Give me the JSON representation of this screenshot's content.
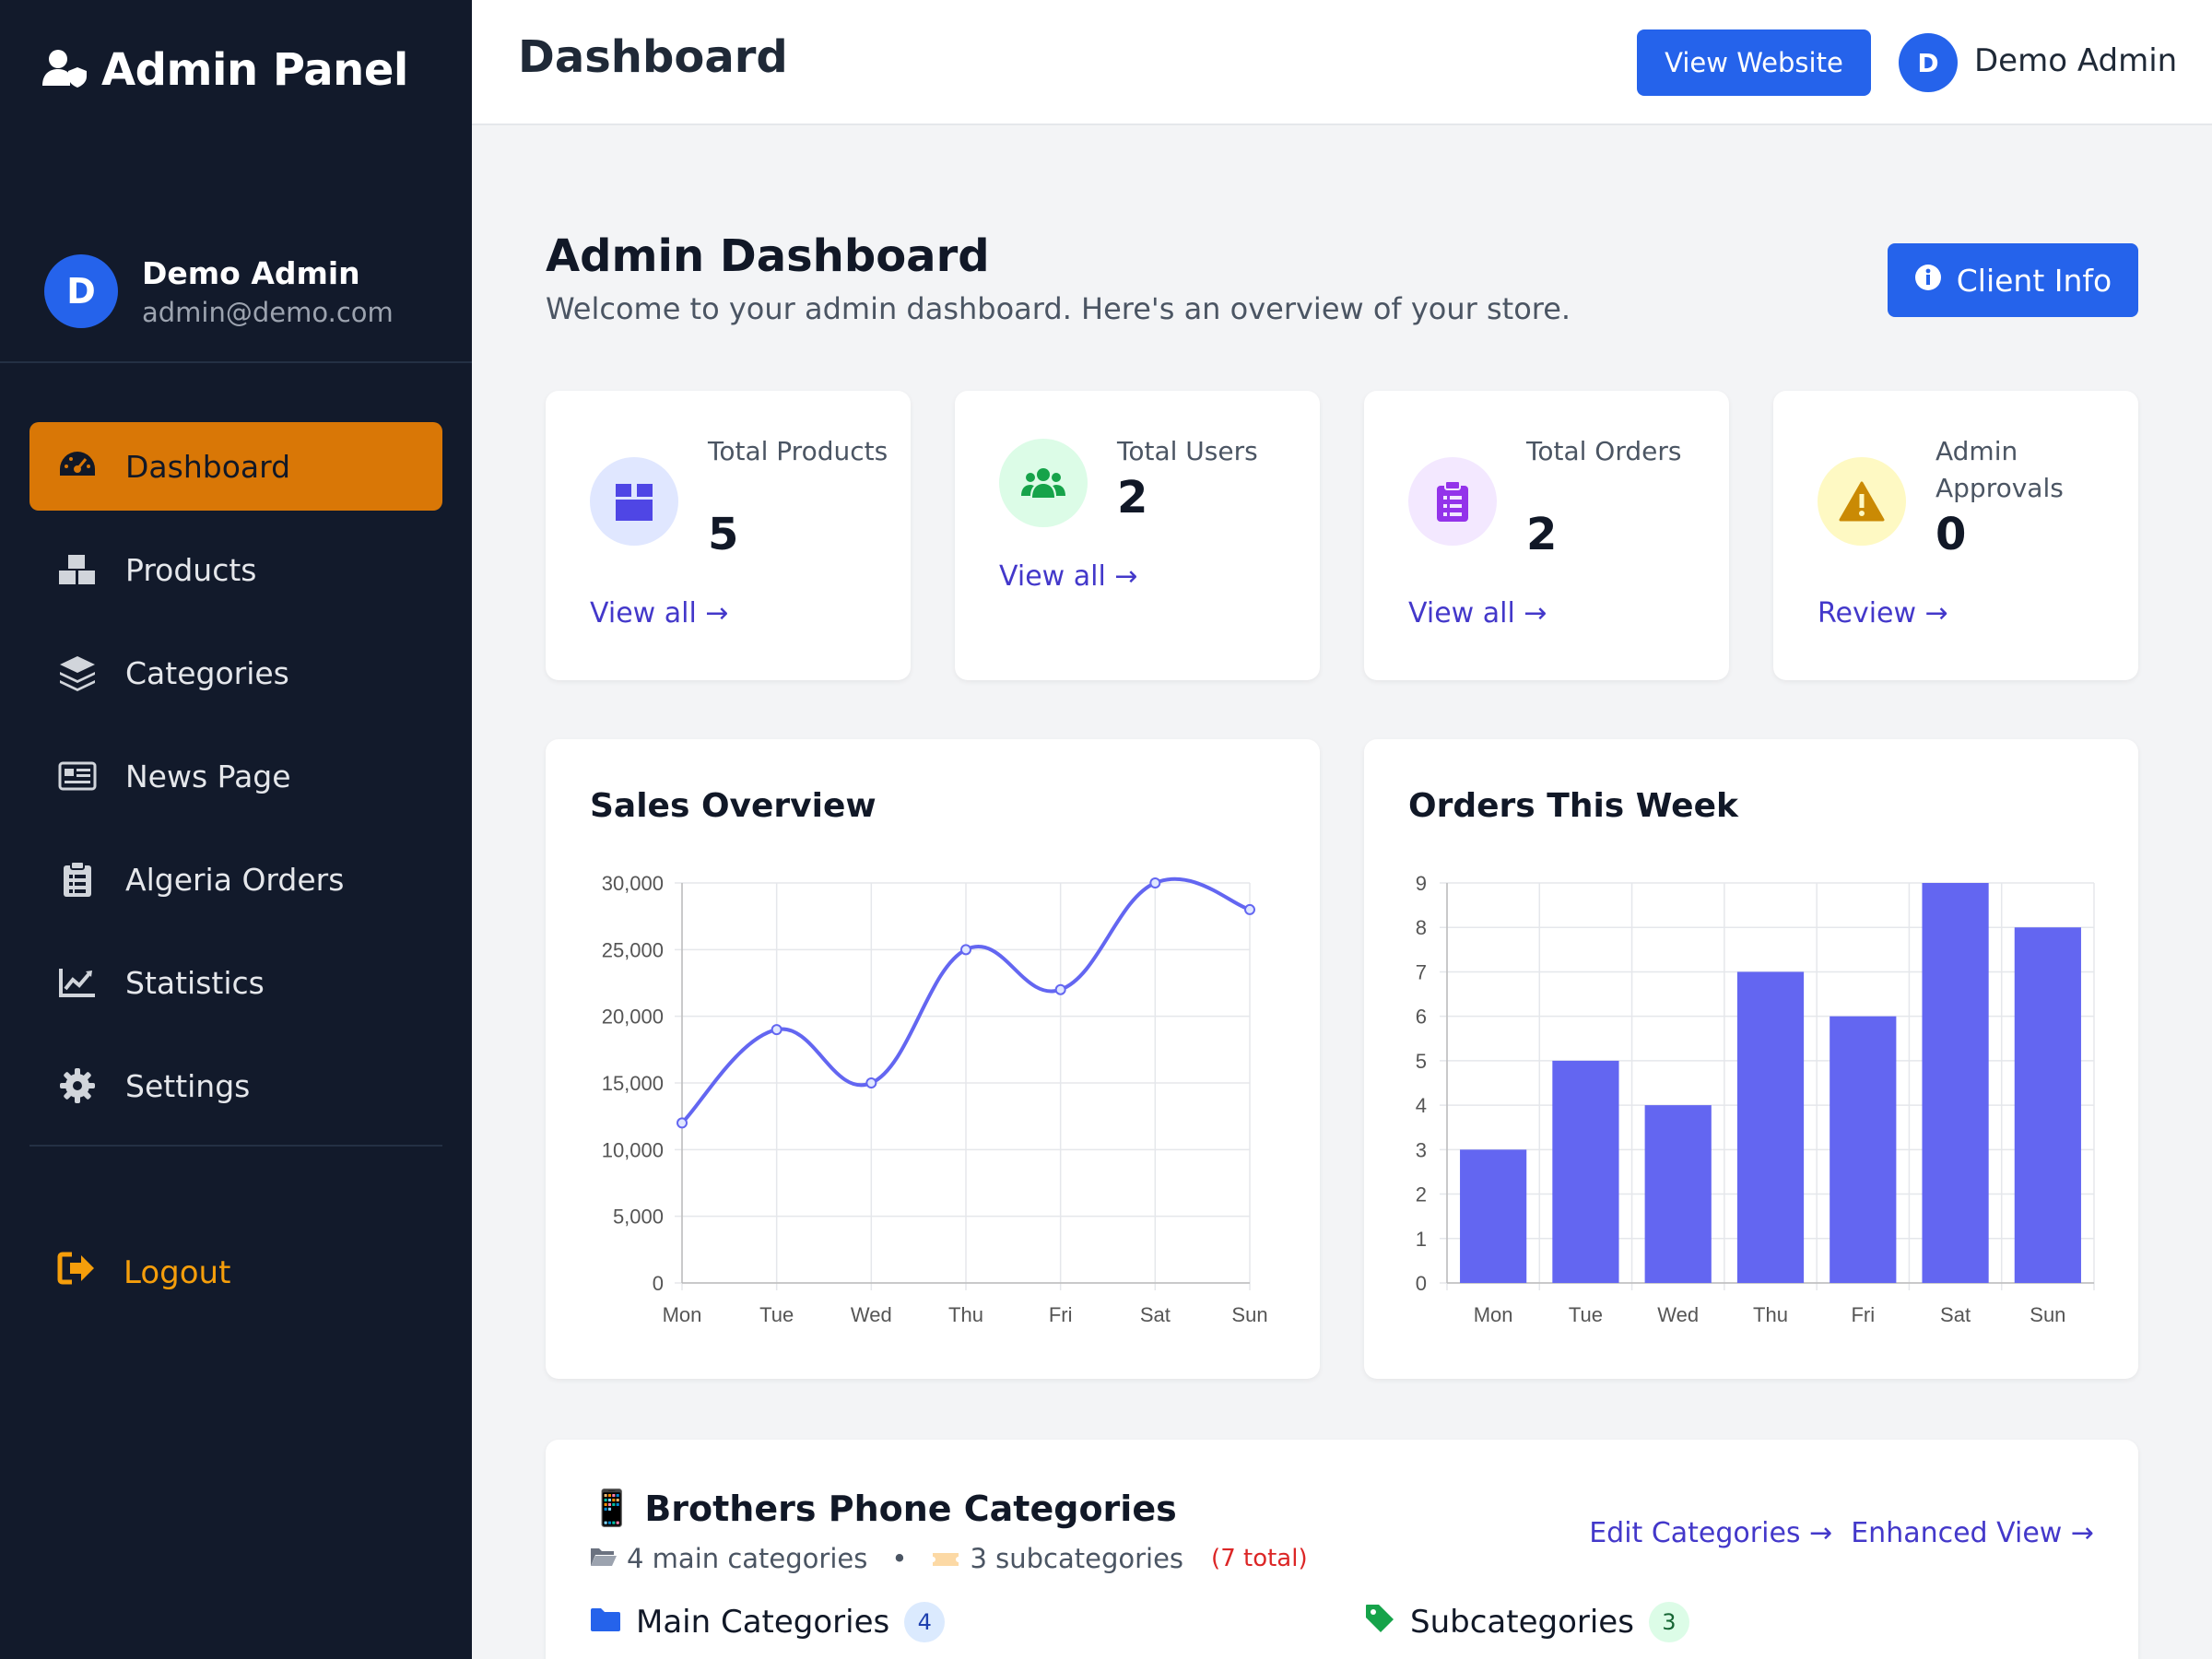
{
  "sidebar": {
    "brand": "Admin Panel",
    "user": {
      "initial": "D",
      "name": "Demo Admin",
      "email": "admin@demo.com"
    },
    "items": [
      {
        "label": "Dashboard",
        "icon": "gauge-icon",
        "active": true
      },
      {
        "label": "Products",
        "icon": "boxes-icon"
      },
      {
        "label": "Categories",
        "icon": "layers-icon"
      },
      {
        "label": "News Page",
        "icon": "newspaper-icon"
      },
      {
        "label": "Algeria Orders",
        "icon": "clipboard-list-icon"
      },
      {
        "label": "Statistics",
        "icon": "chart-line-icon"
      },
      {
        "label": "Settings",
        "icon": "gear-icon"
      }
    ],
    "logout": "Logout"
  },
  "header": {
    "title": "Dashboard",
    "view_website": "View Website",
    "user_initial": "D",
    "user_name": "Demo Admin"
  },
  "welcome": {
    "title": "Admin Dashboard",
    "subtitle": "Welcome to your admin dashboard. Here's an overview of your store.",
    "client_info": "Client Info"
  },
  "stats": [
    {
      "label": "Total Products",
      "value": "5",
      "link": "View all →",
      "icon": "box-icon",
      "color": "#4f46e5",
      "bg": "#e0e7ff"
    },
    {
      "label": "Total Users",
      "value": "2",
      "link": "View all →",
      "icon": "users-icon",
      "color": "#16a34a",
      "bg": "#dcfce7"
    },
    {
      "label": "Total Orders",
      "value": "2",
      "link": "View all →",
      "icon": "clipboard-icon",
      "color": "#9333ea",
      "bg": "#f3e8ff"
    },
    {
      "label": "Admin Approvals",
      "value": "0",
      "link": "Review →",
      "icon": "warning-icon",
      "color": "#ca8a04",
      "bg": "#fef9c3"
    }
  ],
  "chart_data": [
    {
      "type": "line",
      "title": "Sales Overview",
      "categories": [
        "Mon",
        "Tue",
        "Wed",
        "Thu",
        "Fri",
        "Sat",
        "Sun"
      ],
      "values": [
        12000,
        19000,
        15000,
        25000,
        22000,
        30000,
        28000
      ],
      "ylim": [
        0,
        30000
      ],
      "yticks": [
        "0",
        "5,000",
        "10,000",
        "15,000",
        "20,000",
        "25,000",
        "30,000"
      ],
      "grid": true,
      "color": "#6366f1"
    },
    {
      "type": "bar",
      "title": "Orders This Week",
      "categories": [
        "Mon",
        "Tue",
        "Wed",
        "Thu",
        "Fri",
        "Sat",
        "Sun"
      ],
      "values": [
        3,
        5,
        4,
        7,
        6,
        9,
        8
      ],
      "ylim": [
        0,
        9
      ],
      "yticks": [
        "0",
        "1",
        "2",
        "3",
        "4",
        "5",
        "6",
        "7",
        "8",
        "9"
      ],
      "grid": true,
      "color": "#6366f1"
    }
  ],
  "categories_panel": {
    "emoji": "📱",
    "title": "Brothers Phone Categories",
    "main_count_text": "4 main categories",
    "dot": "•",
    "sub_count_text": "3 subcategories",
    "total_text": "(7 total)",
    "edit_link": "Edit Categories →",
    "enhanced_link": "Enhanced View →",
    "main_label": "Main Categories",
    "main_count": "4",
    "sub_label": "Subcategories",
    "sub_count": "3"
  }
}
